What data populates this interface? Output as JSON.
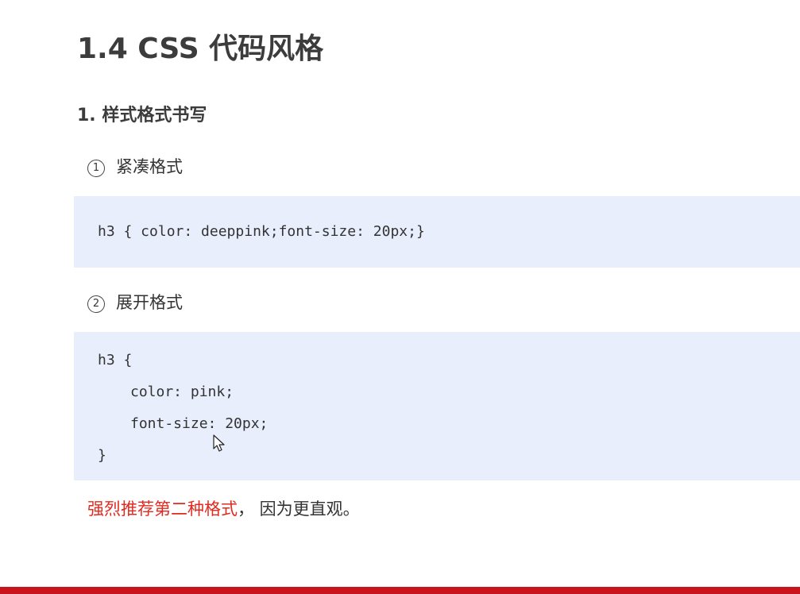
{
  "page": {
    "title": "1.4 CSS 代码风格",
    "subtitle": "1. 样式格式书写"
  },
  "sections": [
    {
      "number": "1",
      "label": "紧凑格式",
      "code_lines": [
        "h3 { color: deeppink;font-size: 20px;}"
      ]
    },
    {
      "number": "2",
      "label": "展开格式",
      "code_lines": [
        "h3 {",
        "color: pink;",
        "font-size: 20px;",
        "}"
      ]
    }
  ],
  "note": {
    "highlight": "强烈推荐第二种格式",
    "rest": "，  因为更直观。"
  },
  "colors": {
    "code_background": "#e8eefc",
    "highlight": "#e02b20",
    "footer_bar": "#c8151d"
  },
  "icons": {
    "cursor": "mouse-pointer-icon"
  }
}
